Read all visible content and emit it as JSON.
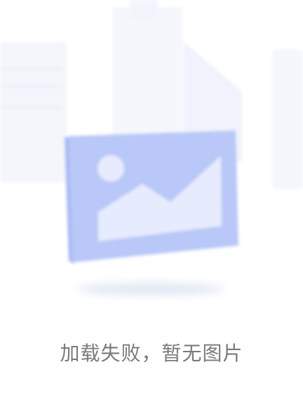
{
  "empty_state": {
    "message": "加载失败，暂无图片",
    "icon": "image-placeholder-icon",
    "colors": {
      "frame": "#b9c8f8",
      "frame_side": "#a9baf3",
      "inner": "#e6ebfd",
      "background_shapes": "#f3f6fd",
      "text": "#7a7a7a"
    }
  }
}
